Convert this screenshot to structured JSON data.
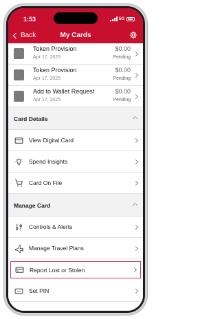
{
  "status_bar": {
    "time": "1:53",
    "network": "5G"
  },
  "header": {
    "back_label": "Back",
    "title": "My Cards"
  },
  "transactions": [
    {
      "title": "Token Provision",
      "date": "Apr 17, 2025",
      "amount": "$0.00",
      "status": "Pending"
    },
    {
      "title": "Token Provision",
      "date": "Apr 17, 2025",
      "amount": "$0.00",
      "status": "Pending"
    },
    {
      "title": "Add to Wallet Request",
      "date": "Apr 17, 2025",
      "amount": "$0.00",
      "status": "Pending"
    }
  ],
  "card_details": {
    "heading": "Card Details",
    "items": [
      {
        "label": "View Digital Card",
        "icon": "card-icon"
      },
      {
        "label": "Spend Insights",
        "icon": "lightbulb-icon"
      },
      {
        "label": "Card On File",
        "icon": "cart-icon"
      }
    ]
  },
  "manage_card": {
    "heading": "Manage Card",
    "items": [
      {
        "label": "Controls & Alerts",
        "icon": "sliders-icon"
      },
      {
        "label": "Manage Travel Plans",
        "icon": "plane-icon"
      },
      {
        "label": "Report Lost or Stolen",
        "icon": "card-alert-icon"
      },
      {
        "label": "Set PIN",
        "icon": "pin-icon"
      }
    ]
  },
  "colors": {
    "brand_red": "#c8102e",
    "highlight_border": "#d32f55"
  }
}
